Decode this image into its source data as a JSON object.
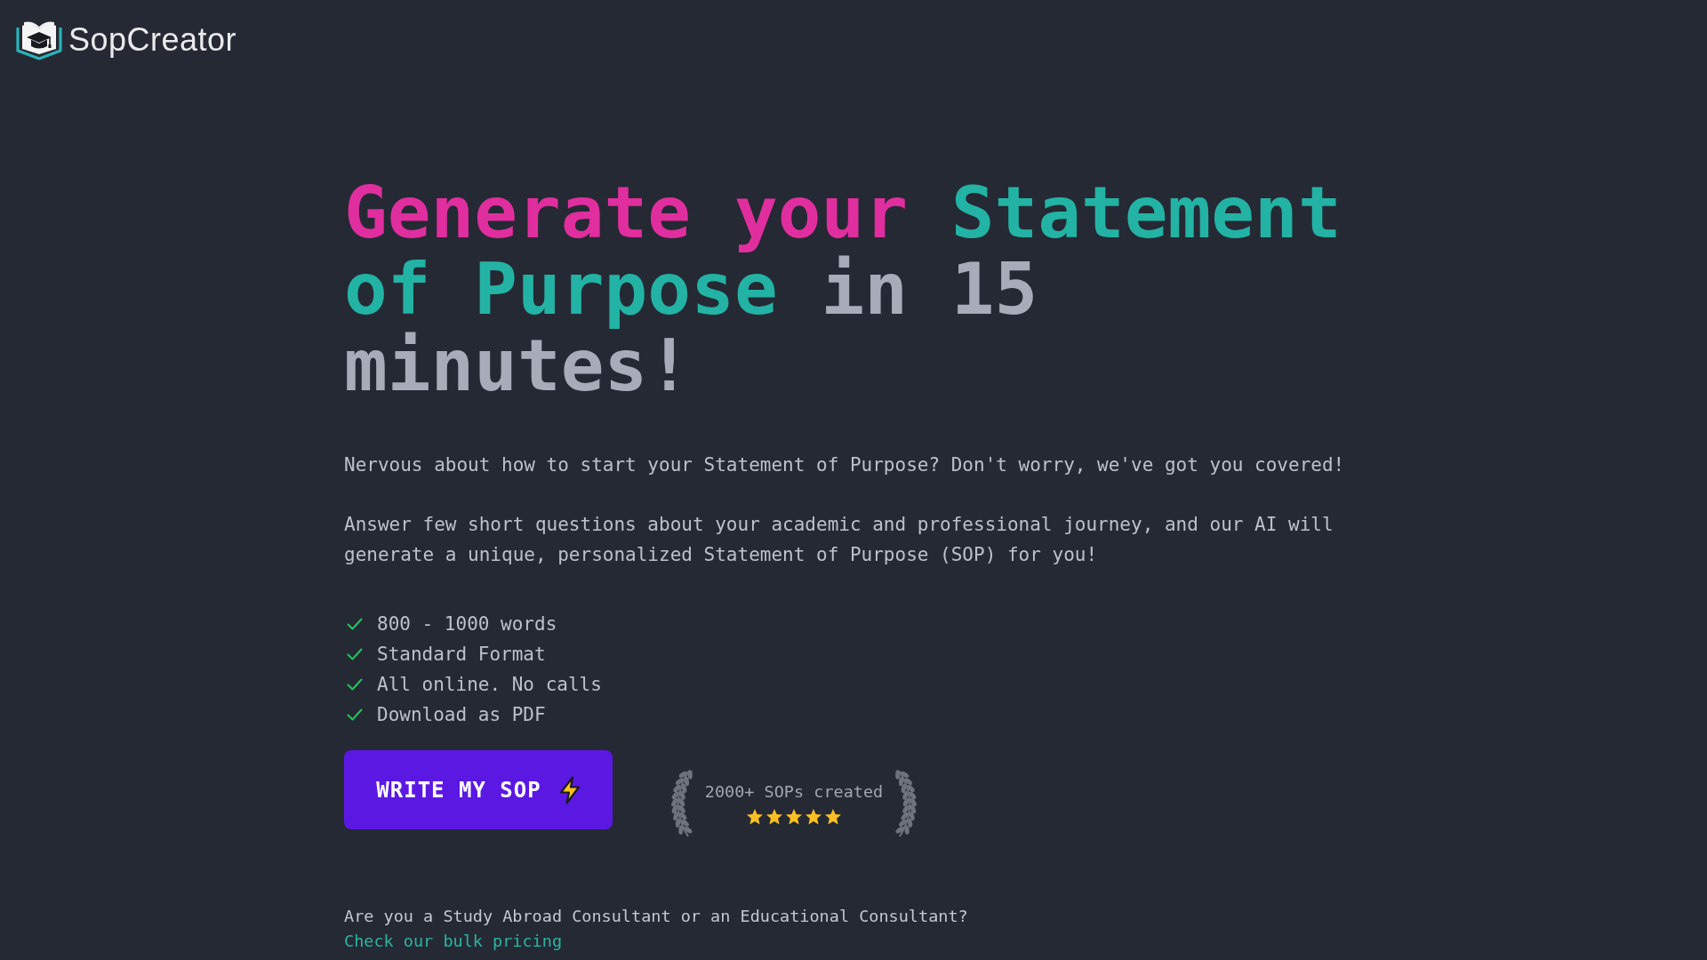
{
  "header": {
    "logo_text": "SopCreator"
  },
  "hero": {
    "headline": [
      {
        "text": "Generate your",
        "color": "#e02e9f"
      },
      {
        "text": "Statement of Purpose",
        "color": "#22b3a5"
      },
      {
        "text": "in 15 minutes!",
        "color": "#a8acb8"
      }
    ],
    "paragraphs": [
      "Nervous about how to start your Statement of Purpose? Don't worry, we've got you covered!",
      "Answer few short questions about your academic and professional journey, and our AI will generate a unique, personalized Statement of Purpose (SOP) for you!"
    ],
    "features": [
      "800 - 1000 words",
      "Standard Format",
      "All online. No calls",
      "Download as PDF"
    ],
    "cta_button": {
      "label": "WRITE MY SOP"
    },
    "badge": {
      "text": "2000+ SOPs created",
      "stars": 5
    },
    "consultant_note": {
      "text": "Are you a Study Abroad Consultant or an Educational Consultant?",
      "link": "Check our bulk pricing"
    }
  }
}
